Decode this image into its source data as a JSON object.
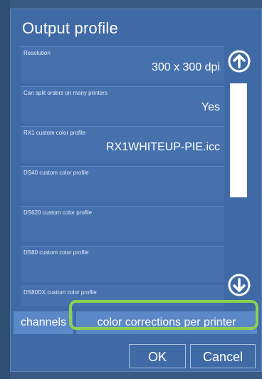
{
  "dialog": {
    "title": "Output profile",
    "settings": [
      {
        "label": "Resolution",
        "value": "300 x 300 dpi"
      },
      {
        "label": "Can split orders on many printers",
        "value": "Yes"
      },
      {
        "label": "RX1 custom color profile",
        "value": "RX1WHITEUP-PIE.icc"
      },
      {
        "label": "DS40 custom color profile",
        "value": ""
      },
      {
        "label": "DS620 custom color profile",
        "value": ""
      },
      {
        "label": "DS80 custom color profile",
        "value": ""
      },
      {
        "label": "DS80DX custom color profile",
        "value": ""
      }
    ],
    "tabs": {
      "channels": "channels",
      "color_corrections": "color corrections per printer"
    },
    "buttons": {
      "ok": "OK",
      "cancel": "Cancel"
    }
  },
  "icons": {
    "scroll_up": "arrow-up-circle-icon",
    "scroll_down": "arrow-down-circle-icon"
  },
  "colors": {
    "dialog_bg": "#3f6aa5",
    "row_bg": "#4671ad",
    "tab_bg": "#5b88c6",
    "highlight": "#8dd050"
  }
}
